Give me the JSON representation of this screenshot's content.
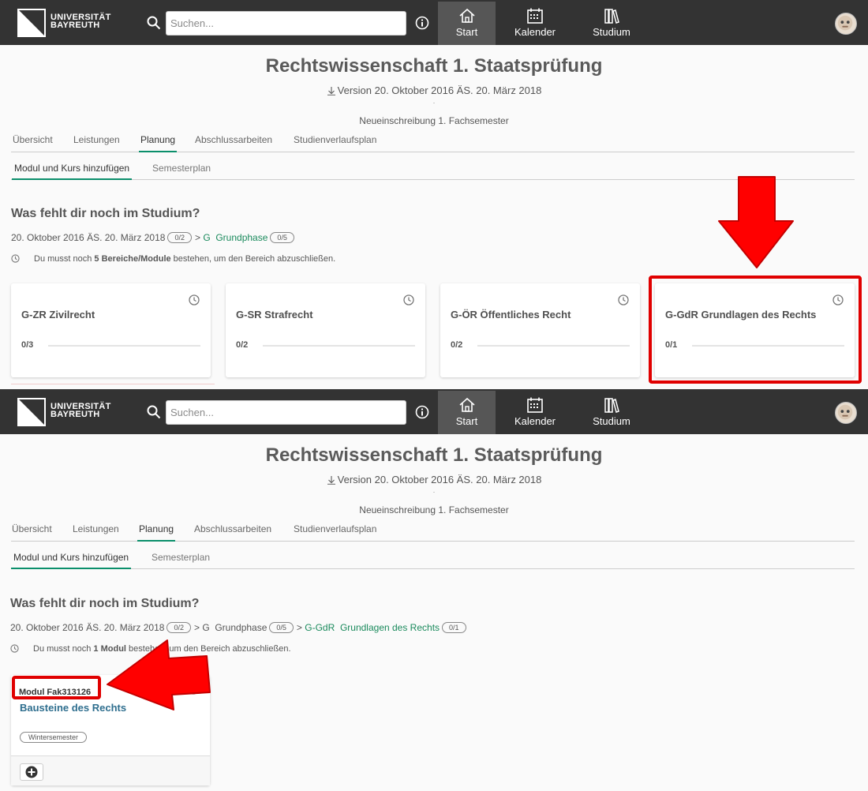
{
  "header": {
    "logo_line1": "UNIVERSITÄT",
    "logo_line2": "BAYREUTH",
    "search_placeholder": "Suchen...",
    "nav": [
      {
        "label": "Start",
        "icon": "home-icon"
      },
      {
        "label": "Kalender",
        "icon": "calendar-icon"
      },
      {
        "label": "Studium",
        "icon": "books-icon"
      }
    ]
  },
  "page": {
    "title": "Rechtswissenschaft 1. Staatsprüfung",
    "version": "Version 20. Oktober 2016 ÄS. 20. März 2018",
    "dot": "·",
    "enrollment": "Neueinschreibung 1. Fachsemester",
    "tabs": [
      "Übersicht",
      "Leistungen",
      "Planung",
      "Abschlussarbeiten",
      "Studienverlaufsplan"
    ],
    "active_tab": "Planung",
    "subtabs": [
      "Modul und Kurs hinzufügen",
      "Semesterplan"
    ],
    "heading": "Was fehlt dir noch im Studium?"
  },
  "panel1": {
    "crumb_version": "20. Oktober 2016 ÄS. 20. März 2018",
    "crumb_version_badge": "0/2",
    "crumb_code": "G",
    "crumb_name": "Grundphase",
    "crumb_badge": "0/5",
    "hint_pre": "Du musst noch ",
    "hint_bold": "5 Bereiche/Module",
    "hint_post": " bestehen, um den Bereich abzuschließen.",
    "cards": [
      {
        "title": "G-ZR Zivilrecht",
        "count": "0/3"
      },
      {
        "title": "G-SR Strafrecht",
        "count": "0/2"
      },
      {
        "title": "G-ÖR Öffentliches Recht",
        "count": "0/2"
      },
      {
        "title": "G-GdR Grundlagen des Rechts",
        "count": "0/1"
      }
    ]
  },
  "panel2": {
    "crumb_version": "20. Oktober 2016 ÄS. 20. März 2018",
    "crumb_version_badge": "0/2",
    "crumb_code": "G",
    "crumb_name": "Grundphase",
    "crumb_badge": "0/5",
    "crumb2_code": "G-GdR",
    "crumb2_name": "Grundlagen des Rechts",
    "crumb2_badge": "0/1",
    "hint_pre": "Du musst noch ",
    "hint_bold": "1 Modul",
    "hint_post": " bestehen, um den Bereich abzuschließen.",
    "module": {
      "label": "Modul Fak313126",
      "title": "Bausteine des Rechts",
      "semester": "Wintersemester"
    }
  },
  "annotation_color": "#e00000",
  "accent_color": "#0b8f6b"
}
